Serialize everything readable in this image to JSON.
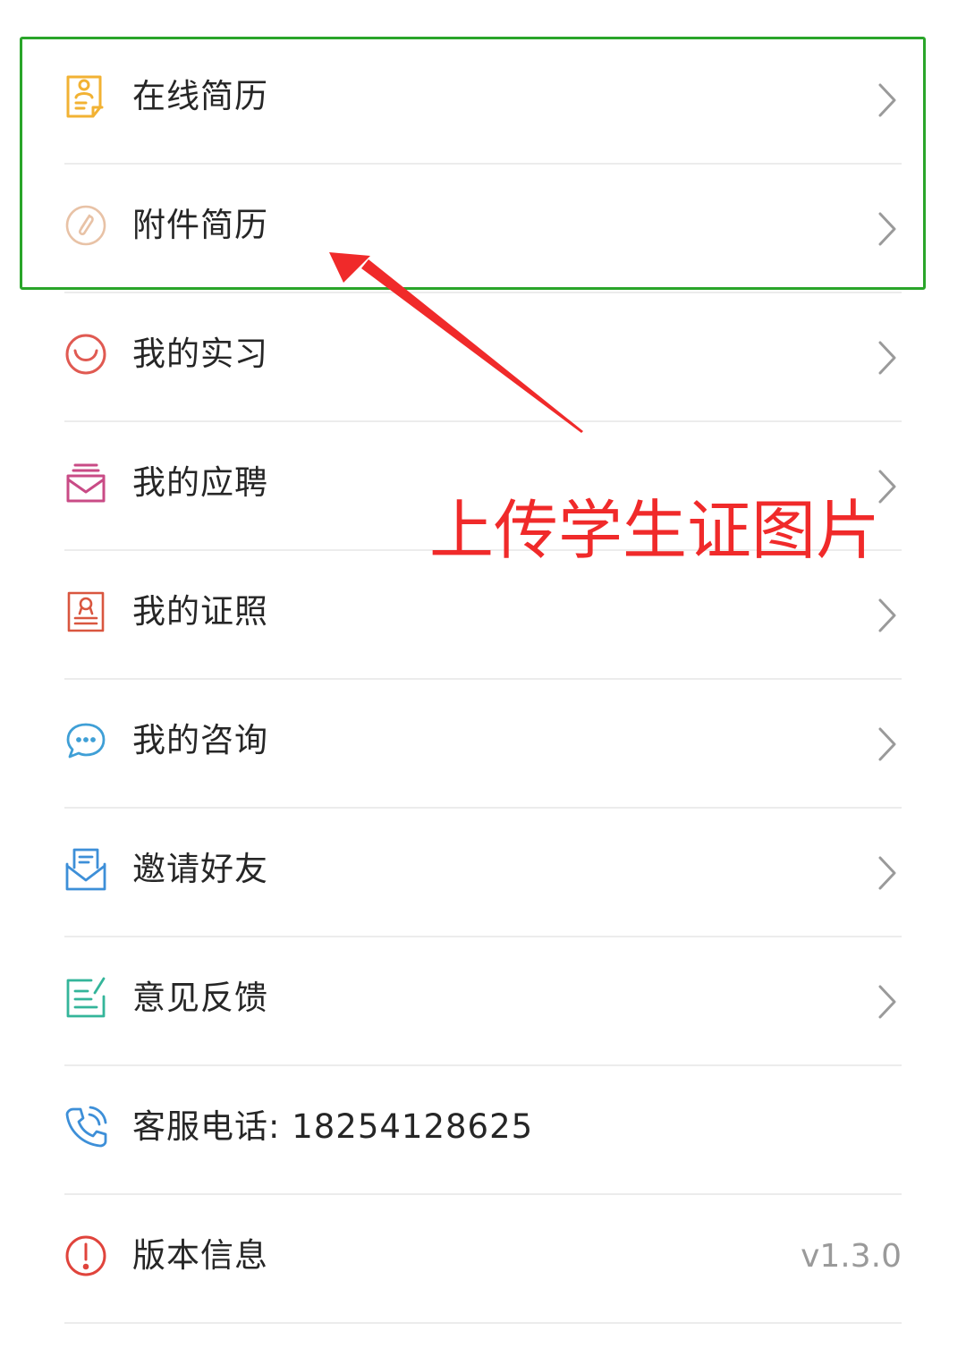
{
  "menu": {
    "items": [
      {
        "label": "在线简历",
        "icon": "resume-icon",
        "icon_color": "#f2b233",
        "chevron": true
      },
      {
        "label": "附件简历",
        "icon": "paperclip-icon",
        "icon_color": "#e8c2a6",
        "chevron": true
      },
      {
        "label": "我的实习",
        "icon": "smile-icon",
        "icon_color": "#e05a52",
        "chevron": true
      },
      {
        "label": "我的应聘",
        "icon": "inbox-icon",
        "icon_color": "#c94b86",
        "chevron": true
      },
      {
        "label": "我的证照",
        "icon": "certificate-icon",
        "icon_color": "#d9563f",
        "chevron": true
      },
      {
        "label": "我的咨询",
        "icon": "chat-icon",
        "icon_color": "#3f9fd6",
        "chevron": true
      },
      {
        "label": "邀请好友",
        "icon": "envelope-icon",
        "icon_color": "#3d8fd8",
        "chevron": true
      },
      {
        "label": "意见反馈",
        "icon": "feedback-icon",
        "icon_color": "#34b59a",
        "chevron": true
      },
      {
        "label": "客服电话: 18254128625",
        "icon": "phone-icon",
        "icon_color": "#3d8fd8",
        "chevron": false
      },
      {
        "label": "版本信息",
        "icon": "info-icon",
        "icon_color": "#e0443c",
        "chevron": false,
        "value": "v1.3.0"
      }
    ]
  },
  "annotation": {
    "text": "上传学生证图片",
    "color": "#f02a2a",
    "highlight_color": "#2aa52a"
  }
}
